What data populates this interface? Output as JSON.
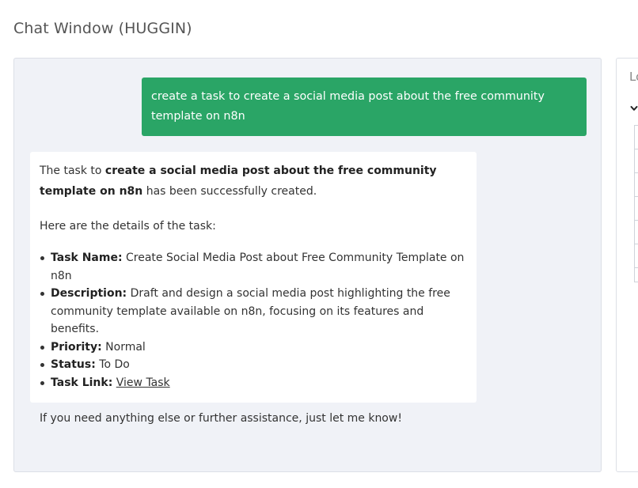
{
  "window": {
    "title": "Chat Window (HUGGIN)"
  },
  "chat": {
    "user_message": "create a task to create a social media post about the free community template on n8n",
    "bot": {
      "intro_prefix": "The task to ",
      "intro_bold": "create a social media post about the free community template on n8n",
      "intro_suffix": " has been successfully created.",
      "details_heading": "Here are the details of the task:",
      "details": [
        {
          "label": "Task Name:",
          "value": " Create Social Media Post about Free Community Template on n8n"
        },
        {
          "label": "Description:",
          "value": " Draft and design a social media post highlighting the free community template available on n8n, focusing on its features and benefits."
        },
        {
          "label": "Priority:",
          "value": " Normal"
        },
        {
          "label": "Status:",
          "value": " To Do"
        },
        {
          "label": "Task Link:",
          "value": " ",
          "link": "View Task"
        }
      ],
      "closing": "If you need anything else or further assistance, just let me know!"
    }
  },
  "side_panel": {
    "label": "Lo"
  }
}
